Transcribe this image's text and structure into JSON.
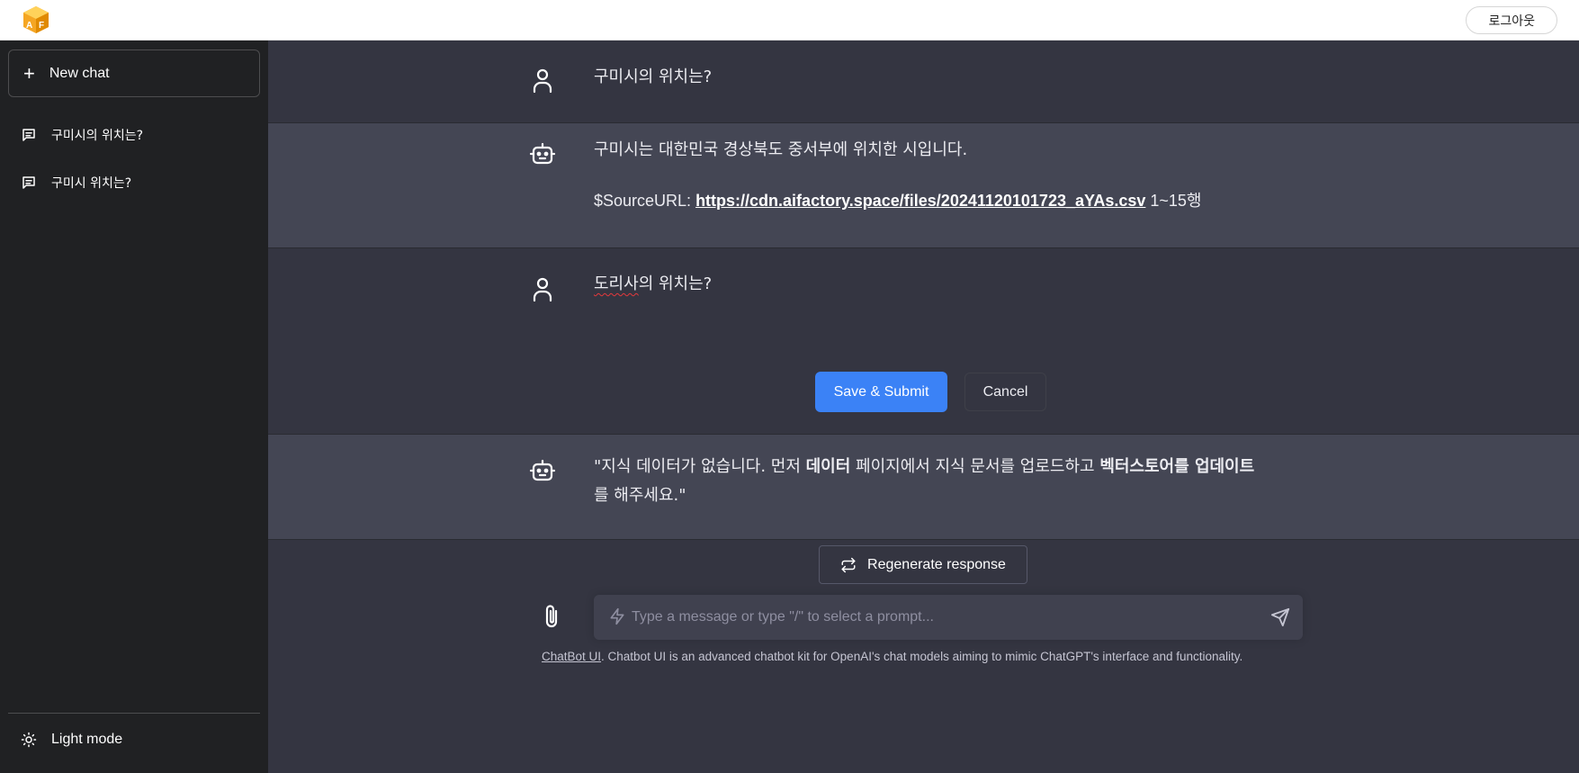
{
  "topbar": {
    "logo_letters": [
      "A",
      "F"
    ],
    "logout_label": "로그아웃"
  },
  "sidebar": {
    "new_chat_label": "New chat",
    "conversations": [
      {
        "title": "구미시의 위치는?"
      },
      {
        "title": "구미시 위치는?"
      }
    ],
    "light_mode_label": "Light mode"
  },
  "messages": [
    {
      "role": "user",
      "text": "구미시의 위치는?"
    },
    {
      "role": "assistant",
      "text": "구미시는 대한민국 경상북도 중서부에 위치한 시입니다.",
      "source_prefix": "$SourceURL: ",
      "source_url": "https://cdn.aifactory.space/files/20241120101723_aYAs.csv",
      "source_suffix": " 1~15행"
    },
    {
      "role": "user",
      "text_spell": "도리사",
      "text_rest": "의 위치는?",
      "save_label": "Save & Submit",
      "cancel_label": "Cancel"
    },
    {
      "role": "assistant",
      "parts": [
        "\"지식 데이터가 없습니다. 먼저 ",
        "데이터",
        " 페이지에서 지식 문서를 업로드하고 ",
        "벡터스토어를 업데이트",
        "를 해주세요.\""
      ]
    }
  ],
  "regenerate_label": "Regenerate response",
  "input": {
    "placeholder": "Type a message or type \"/\" to select a prompt...",
    "value": ""
  },
  "footer": {
    "link_text": "ChatBot UI",
    "text": ". Chatbot UI is an advanced chatbot kit for OpenAI's chat models aiming to mimic ChatGPT's interface and functionality."
  },
  "colors": {
    "accent": "#3b82f6",
    "sidebar_bg": "#202123",
    "main_bg": "#343541",
    "bot_bg": "#444654"
  }
}
